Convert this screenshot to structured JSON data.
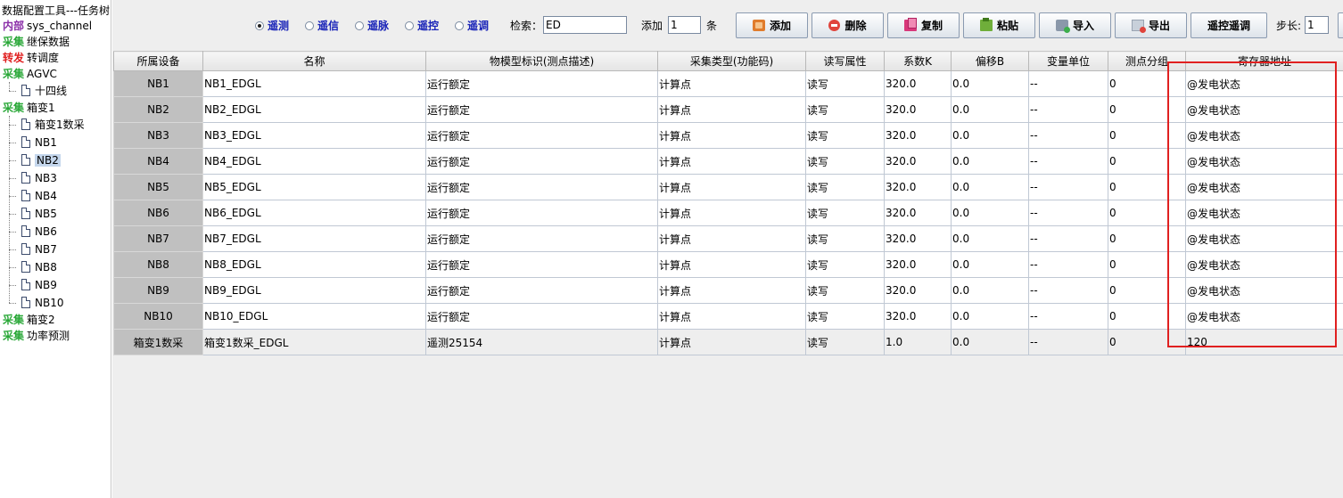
{
  "tree": {
    "title": "数据配置工具---任务树",
    "nodes": [
      {
        "tag": "内部",
        "tag_color": "#8a2ea8",
        "label": "sys_channel"
      },
      {
        "tag": "采集",
        "tag_color": "#2aa838",
        "label": "继保数据"
      },
      {
        "tag": "转发",
        "tag_color": "#e02020",
        "label": "转调度"
      },
      {
        "tag": "采集",
        "tag_color": "#2aa838",
        "label": "AGVC"
      },
      {
        "tag": "采集",
        "tag_color": "#2aa838",
        "label": "箱变1"
      },
      {
        "tag": "采集",
        "tag_color": "#2aa838",
        "label": "箱变2"
      },
      {
        "tag": "采集",
        "tag_color": "#2aa838",
        "label": "功率预测"
      }
    ],
    "agvc_children": [
      "十四线"
    ],
    "xb1_children": [
      "箱变1数采",
      "NB1",
      "NB2",
      "NB3",
      "NB4",
      "NB5",
      "NB6",
      "NB7",
      "NB8",
      "NB9",
      "NB10"
    ],
    "selected": "NB2"
  },
  "toolbar": {
    "radios": [
      {
        "label": "遥测",
        "checked": true
      },
      {
        "label": "遥信",
        "checked": false
      },
      {
        "label": "遥脉",
        "checked": false
      },
      {
        "label": "遥控",
        "checked": false
      },
      {
        "label": "遥调",
        "checked": false
      }
    ],
    "search_label": "检索：",
    "search_value": "ED",
    "add_label": "添加",
    "add_count": "1",
    "add_unit": "条",
    "buttons": {
      "add": "添加",
      "delete": "删除",
      "copy": "复制",
      "paste": "粘贴",
      "import": "导入",
      "export": "导出",
      "remote": "遥控遥调"
    },
    "step_label": "步长:",
    "step_value": "1"
  },
  "table": {
    "columns": [
      "所属设备",
      "名称",
      "物模型标识(测点描述)",
      "采集类型(功能码)",
      "读写属性",
      "系数K",
      "偏移B",
      "变量单位",
      "测点分组",
      "寄存器地址"
    ],
    "rows": [
      [
        "NB1",
        "NB1_EDGL",
        "运行额定",
        "计算点",
        "读写",
        "320.0",
        "0.0",
        "--",
        "0",
        "@发电状态"
      ],
      [
        "NB2",
        "NB2_EDGL",
        "运行额定",
        "计算点",
        "读写",
        "320.0",
        "0.0",
        "--",
        "0",
        "@发电状态"
      ],
      [
        "NB3",
        "NB3_EDGL",
        "运行额定",
        "计算点",
        "读写",
        "320.0",
        "0.0",
        "--",
        "0",
        "@发电状态"
      ],
      [
        "NB4",
        "NB4_EDGL",
        "运行额定",
        "计算点",
        "读写",
        "320.0",
        "0.0",
        "--",
        "0",
        "@发电状态"
      ],
      [
        "NB5",
        "NB5_EDGL",
        "运行额定",
        "计算点",
        "读写",
        "320.0",
        "0.0",
        "--",
        "0",
        "@发电状态"
      ],
      [
        "NB6",
        "NB6_EDGL",
        "运行额定",
        "计算点",
        "读写",
        "320.0",
        "0.0",
        "--",
        "0",
        "@发电状态"
      ],
      [
        "NB7",
        "NB7_EDGL",
        "运行额定",
        "计算点",
        "读写",
        "320.0",
        "0.0",
        "--",
        "0",
        "@发电状态"
      ],
      [
        "NB8",
        "NB8_EDGL",
        "运行额定",
        "计算点",
        "读写",
        "320.0",
        "0.0",
        "--",
        "0",
        "@发电状态"
      ],
      [
        "NB9",
        "NB9_EDGL",
        "运行额定",
        "计算点",
        "读写",
        "320.0",
        "0.0",
        "--",
        "0",
        "@发电状态"
      ],
      [
        "NB10",
        "NB10_EDGL",
        "运行额定",
        "计算点",
        "读写",
        "320.0",
        "0.0",
        "--",
        "0",
        "@发电状态"
      ],
      [
        "箱变1数采",
        "箱变1数采_EDGL",
        "遥测25154",
        "计算点",
        "读写",
        "1.0",
        "0.0",
        "--",
        "0",
        "120"
      ]
    ]
  },
  "highlight_color": "#e02020"
}
